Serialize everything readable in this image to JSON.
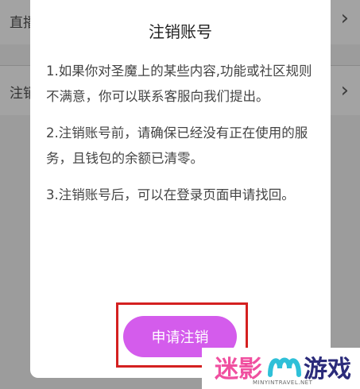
{
  "background": {
    "row1_label": "直播",
    "row2_label": "注销"
  },
  "dialog": {
    "title": "注销账号",
    "paragraphs": [
      "1.如果你对圣魔上的某些内容,功能或社区规则不满意，你可以联系客服向我们提出。",
      "2.注销账号前，请确保已经没有正在使用的服务，且钱包的余额已清零。",
      "3.注销账号后，可以在登录页面申请找回。"
    ],
    "button_label": "申请注销"
  },
  "watermark": {
    "text_left": "迷影",
    "text_right": "游戏",
    "url": "MINYINTRAVEL.NET"
  },
  "icons": {
    "chevron": "chevron-right-icon"
  },
  "colors": {
    "accent": "#d45cec",
    "highlight": "#d42020"
  }
}
